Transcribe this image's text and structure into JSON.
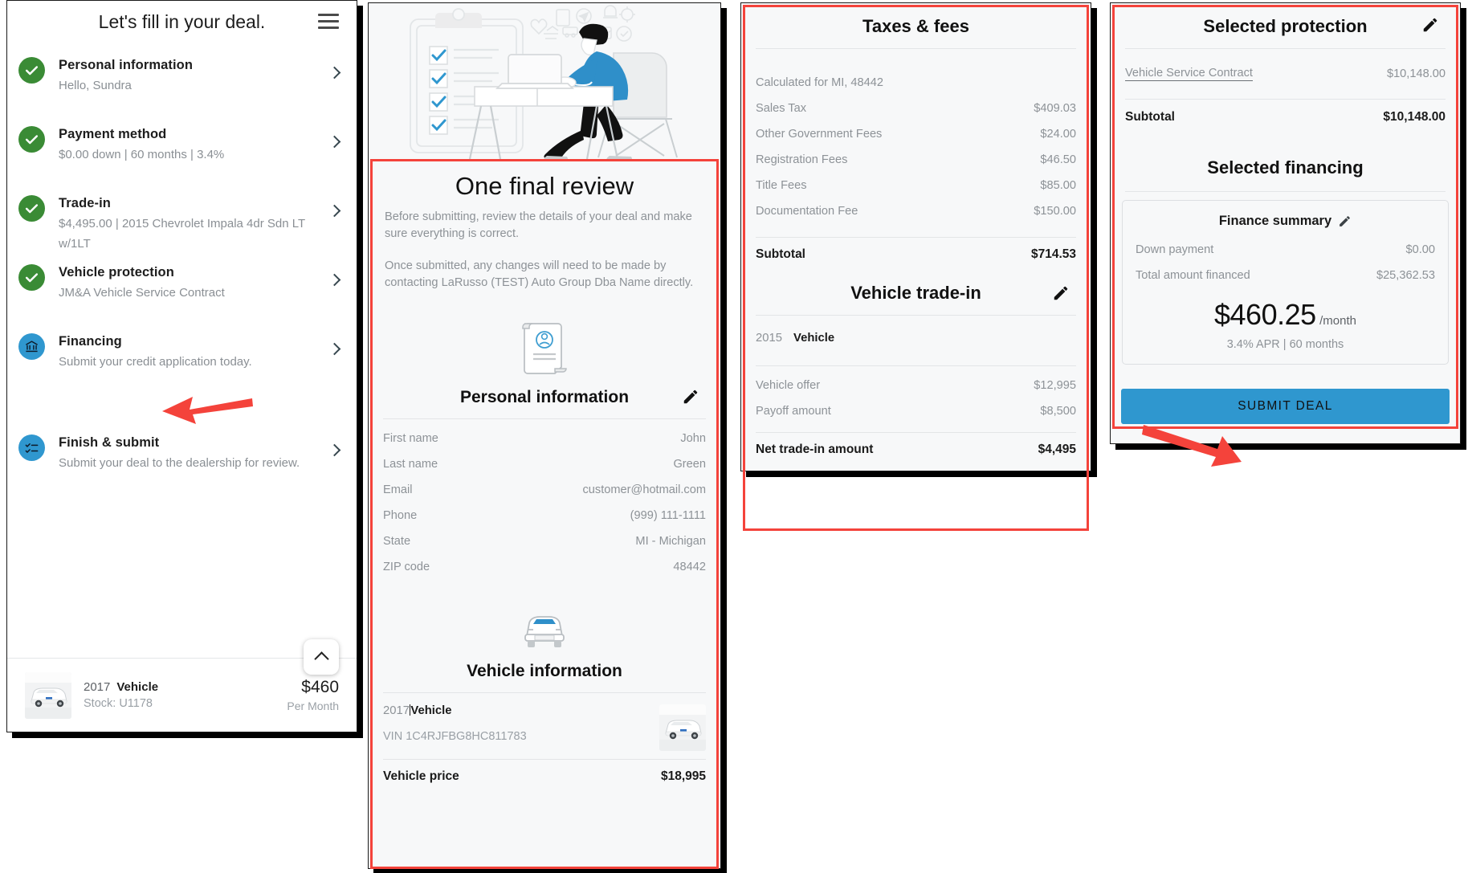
{
  "sidebar": {
    "title": "Let's fill in your deal.",
    "menu_icon": "hamburger-icon",
    "items": [
      {
        "label": "Personal information",
        "sub": "Hello, Sundra",
        "state": "complete",
        "icon": "check-icon"
      },
      {
        "label": "Payment method",
        "sub": "$0.00 down | 60 months | 3.4%",
        "state": "complete",
        "icon": "check-icon"
      },
      {
        "label": "Trade-in",
        "sub": "$4,495.00 | 2015 Chevrolet Impala 4dr Sdn LT w/1LT",
        "state": "complete",
        "icon": "check-icon"
      },
      {
        "label": "Vehicle protection",
        "sub": "JM&A Vehicle Service Contract",
        "state": "complete",
        "icon": "check-icon"
      },
      {
        "label": "Financing",
        "sub": "Submit your credit application today.",
        "state": "active",
        "icon": "bank-icon"
      },
      {
        "label": "Finish & submit",
        "sub": "Submit your deal to the dealership for review.",
        "state": "active",
        "icon": "checklist-icon"
      }
    ],
    "deal_bar": {
      "year": "2017",
      "vehicle": "Vehicle",
      "stock": "Stock: U1178",
      "price": "$460",
      "period": "Per Month",
      "collapse_icon": "chevron-up-icon"
    }
  },
  "review": {
    "hero_icon": "person-at-desk-illustration",
    "title": "One final review",
    "paragraph1": "Before submitting, review the details of your deal and make sure everything is correct.",
    "paragraph2": "Once submitted, any changes will need to be made by contacting LaRusso (TEST) Auto Group Dba Name directly.",
    "personal": {
      "icon": "document-person-icon",
      "title": "Personal information",
      "edit_icon": "pencil-icon",
      "rows": [
        {
          "label": "First name",
          "value": "John"
        },
        {
          "label": "Last name",
          "value": "Green"
        },
        {
          "label": "Email",
          "value": "customer@hotmail.com"
        },
        {
          "label": "Phone",
          "value": "(999) 111-1111"
        },
        {
          "label": "State",
          "value": "MI - Michigan"
        },
        {
          "label": "ZIP code",
          "value": "48442"
        }
      ]
    },
    "vehicle": {
      "icon": "car-front-icon",
      "title": "Vehicle information",
      "year": "2017",
      "name": "Vehicle",
      "vin_label": "VIN",
      "vin": "1C4RJFBG8HC811783",
      "price_label": "Vehicle price",
      "price": "$18,995"
    }
  },
  "taxes": {
    "title": "Taxes & fees",
    "calculated_for": "Calculated for MI, 48442",
    "rows": [
      {
        "label": "Sales Tax",
        "value": "$409.03"
      },
      {
        "label": "Other Government Fees",
        "value": "$24.00"
      },
      {
        "label": "Registration Fees",
        "value": "$46.50"
      },
      {
        "label": "Title Fees",
        "value": "$85.00"
      },
      {
        "label": "Documentation Fee",
        "value": "$150.00"
      }
    ],
    "subtotal_label": "Subtotal",
    "subtotal_value": "$714.53"
  },
  "trade_in": {
    "title": "Vehicle trade-in",
    "edit_icon": "pencil-icon",
    "year": "2015",
    "name": "Vehicle",
    "rows": [
      {
        "label": "Vehicle offer",
        "value": "$12,995"
      },
      {
        "label": "Payoff amount",
        "value": "$8,500"
      }
    ],
    "net_label": "Net trade-in amount",
    "net_value": "$4,495"
  },
  "protection": {
    "title": "Selected protection",
    "edit_icon": "pencil-icon",
    "rows": [
      {
        "label": "Vehicle Service Contract",
        "value": "$10,148.00"
      }
    ],
    "subtotal_label": "Subtotal",
    "subtotal_value": "$10,148.00"
  },
  "financing": {
    "title": "Selected financing",
    "summary_title": "Finance summary",
    "edit_icon": "pencil-icon",
    "rows": [
      {
        "label": "Down payment",
        "value": "$0.00"
      },
      {
        "label": "Total amount financed",
        "value": "$25,362.53"
      }
    ],
    "payment_amount": "$460.25",
    "payment_period": "/month",
    "terms": "3.4% APR | 60 months",
    "submit_label": "SUBMIT DEAL"
  },
  "colors": {
    "brand_blue": "#2f97cf",
    "complete_green": "#3a8b35",
    "highlight_red": "#f4433b",
    "panel_bg": "#f7f8f9"
  }
}
